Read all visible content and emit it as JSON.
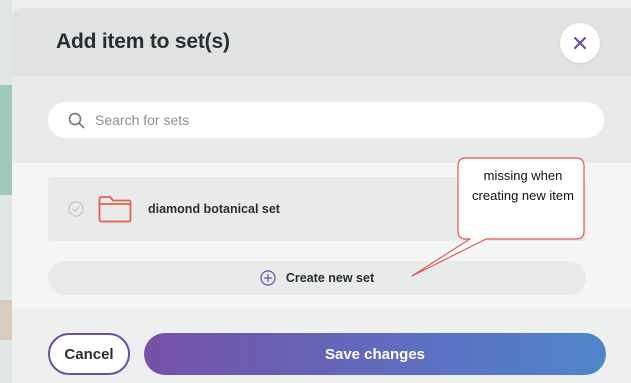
{
  "modal": {
    "title": "Add item to set(s)",
    "close_icon": "close-icon"
  },
  "search": {
    "placeholder": "Search for sets",
    "value": "",
    "icon": "search-icon"
  },
  "sets": [
    {
      "name": "diamond botanical set",
      "checked": false,
      "icon": "folder-icon"
    }
  ],
  "create_new": {
    "label": "Create new set",
    "icon": "plus-circle-icon"
  },
  "footer": {
    "cancel_label": "Cancel",
    "save_label": "Save changes"
  },
  "annotation": {
    "text": "missing when creating new item"
  },
  "colors": {
    "accent": "#6c4da3",
    "folder": "#e8604c",
    "callout_border": "#e05a4e",
    "save_gradient_start": "#7651a6",
    "save_gradient_end": "#4f86c9"
  }
}
